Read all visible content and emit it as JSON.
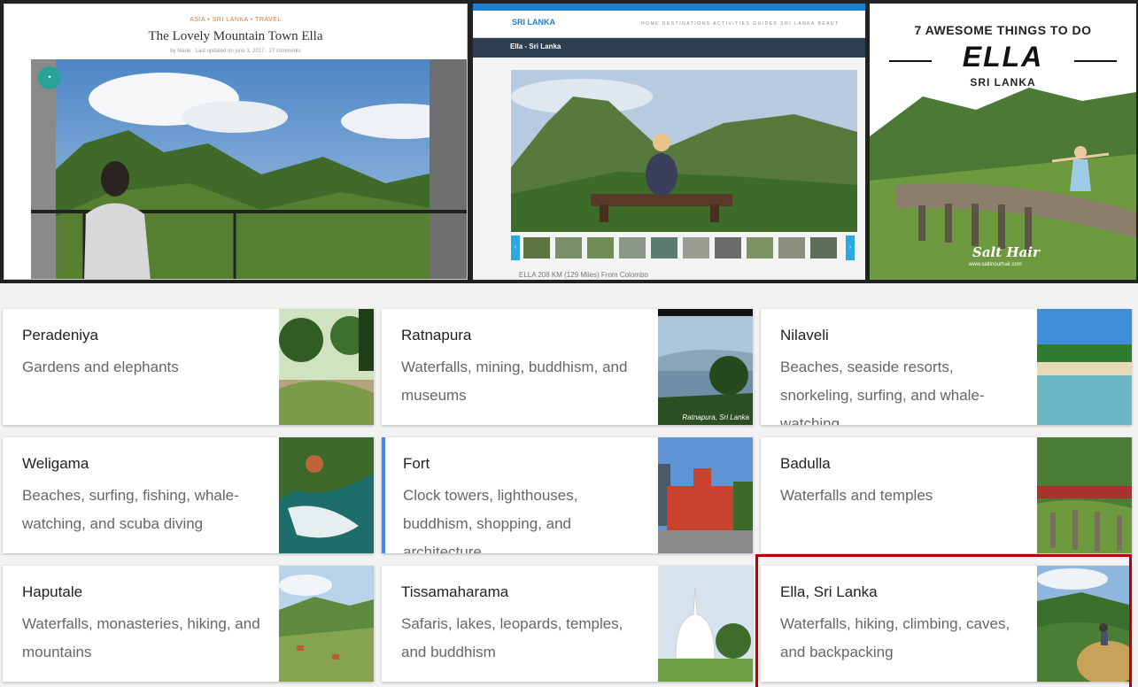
{
  "top_images": {
    "blog": {
      "categories": "ASIA  •  SRI LANKA  •  TRAVEL",
      "title": "The Lovely Mountain Town Ella",
      "meta": "by Marie  ·  Last updated on june 3, 2017  ·  27 comments"
    },
    "site": {
      "logo": "SRI LANKA",
      "nav_links": "HOME   DESTINATIONS   ACTIVITIES   GUIDES   SRI LANKA   BEAUT",
      "page_title": "Ella - Sri Lanka",
      "caption": "ELLA 208 KM (129 Miles) From Colombo"
    },
    "poster": {
      "headline": "7 AWESOME THINGS TO DO",
      "place": "ELLA",
      "country": "SRI LANKA",
      "logo": "Salt Hair",
      "url": "www.saltinourhair.com"
    }
  },
  "cards": [
    {
      "title": "Peradeniya",
      "desc": "Gardens and elephants"
    },
    {
      "title": "Ratnapura",
      "desc": "Waterfalls, mining, buddhism, and museums"
    },
    {
      "title": "Nilaveli",
      "desc": "Beaches, seaside resorts, snorkeling, surfing, and whale-watching"
    },
    {
      "title": "Weligama",
      "desc": "Beaches, surfing, fishing, whale-watching, and scuba diving"
    },
    {
      "title": "Fort",
      "desc": "Clock towers, lighthouses, buddhism, shopping, and architecture"
    },
    {
      "title": "Badulla",
      "desc": "Waterfalls and temples"
    },
    {
      "title": "Haputale",
      "desc": "Waterfalls, monasteries, hiking, and mountains"
    },
    {
      "title": "Tissamaharama",
      "desc": "Safaris, lakes, leopards, temples, and buddhism"
    },
    {
      "title": "Ella, Sri Lanka",
      "desc": "Waterfalls, hiking, climbing, caves, and backpacking"
    }
  ],
  "ratnapura_watermark": "Ratnapura, Sri Lanka",
  "colors": {
    "accent": "#4285f4",
    "highlight": "#b80000",
    "badge": "#27a39a"
  }
}
